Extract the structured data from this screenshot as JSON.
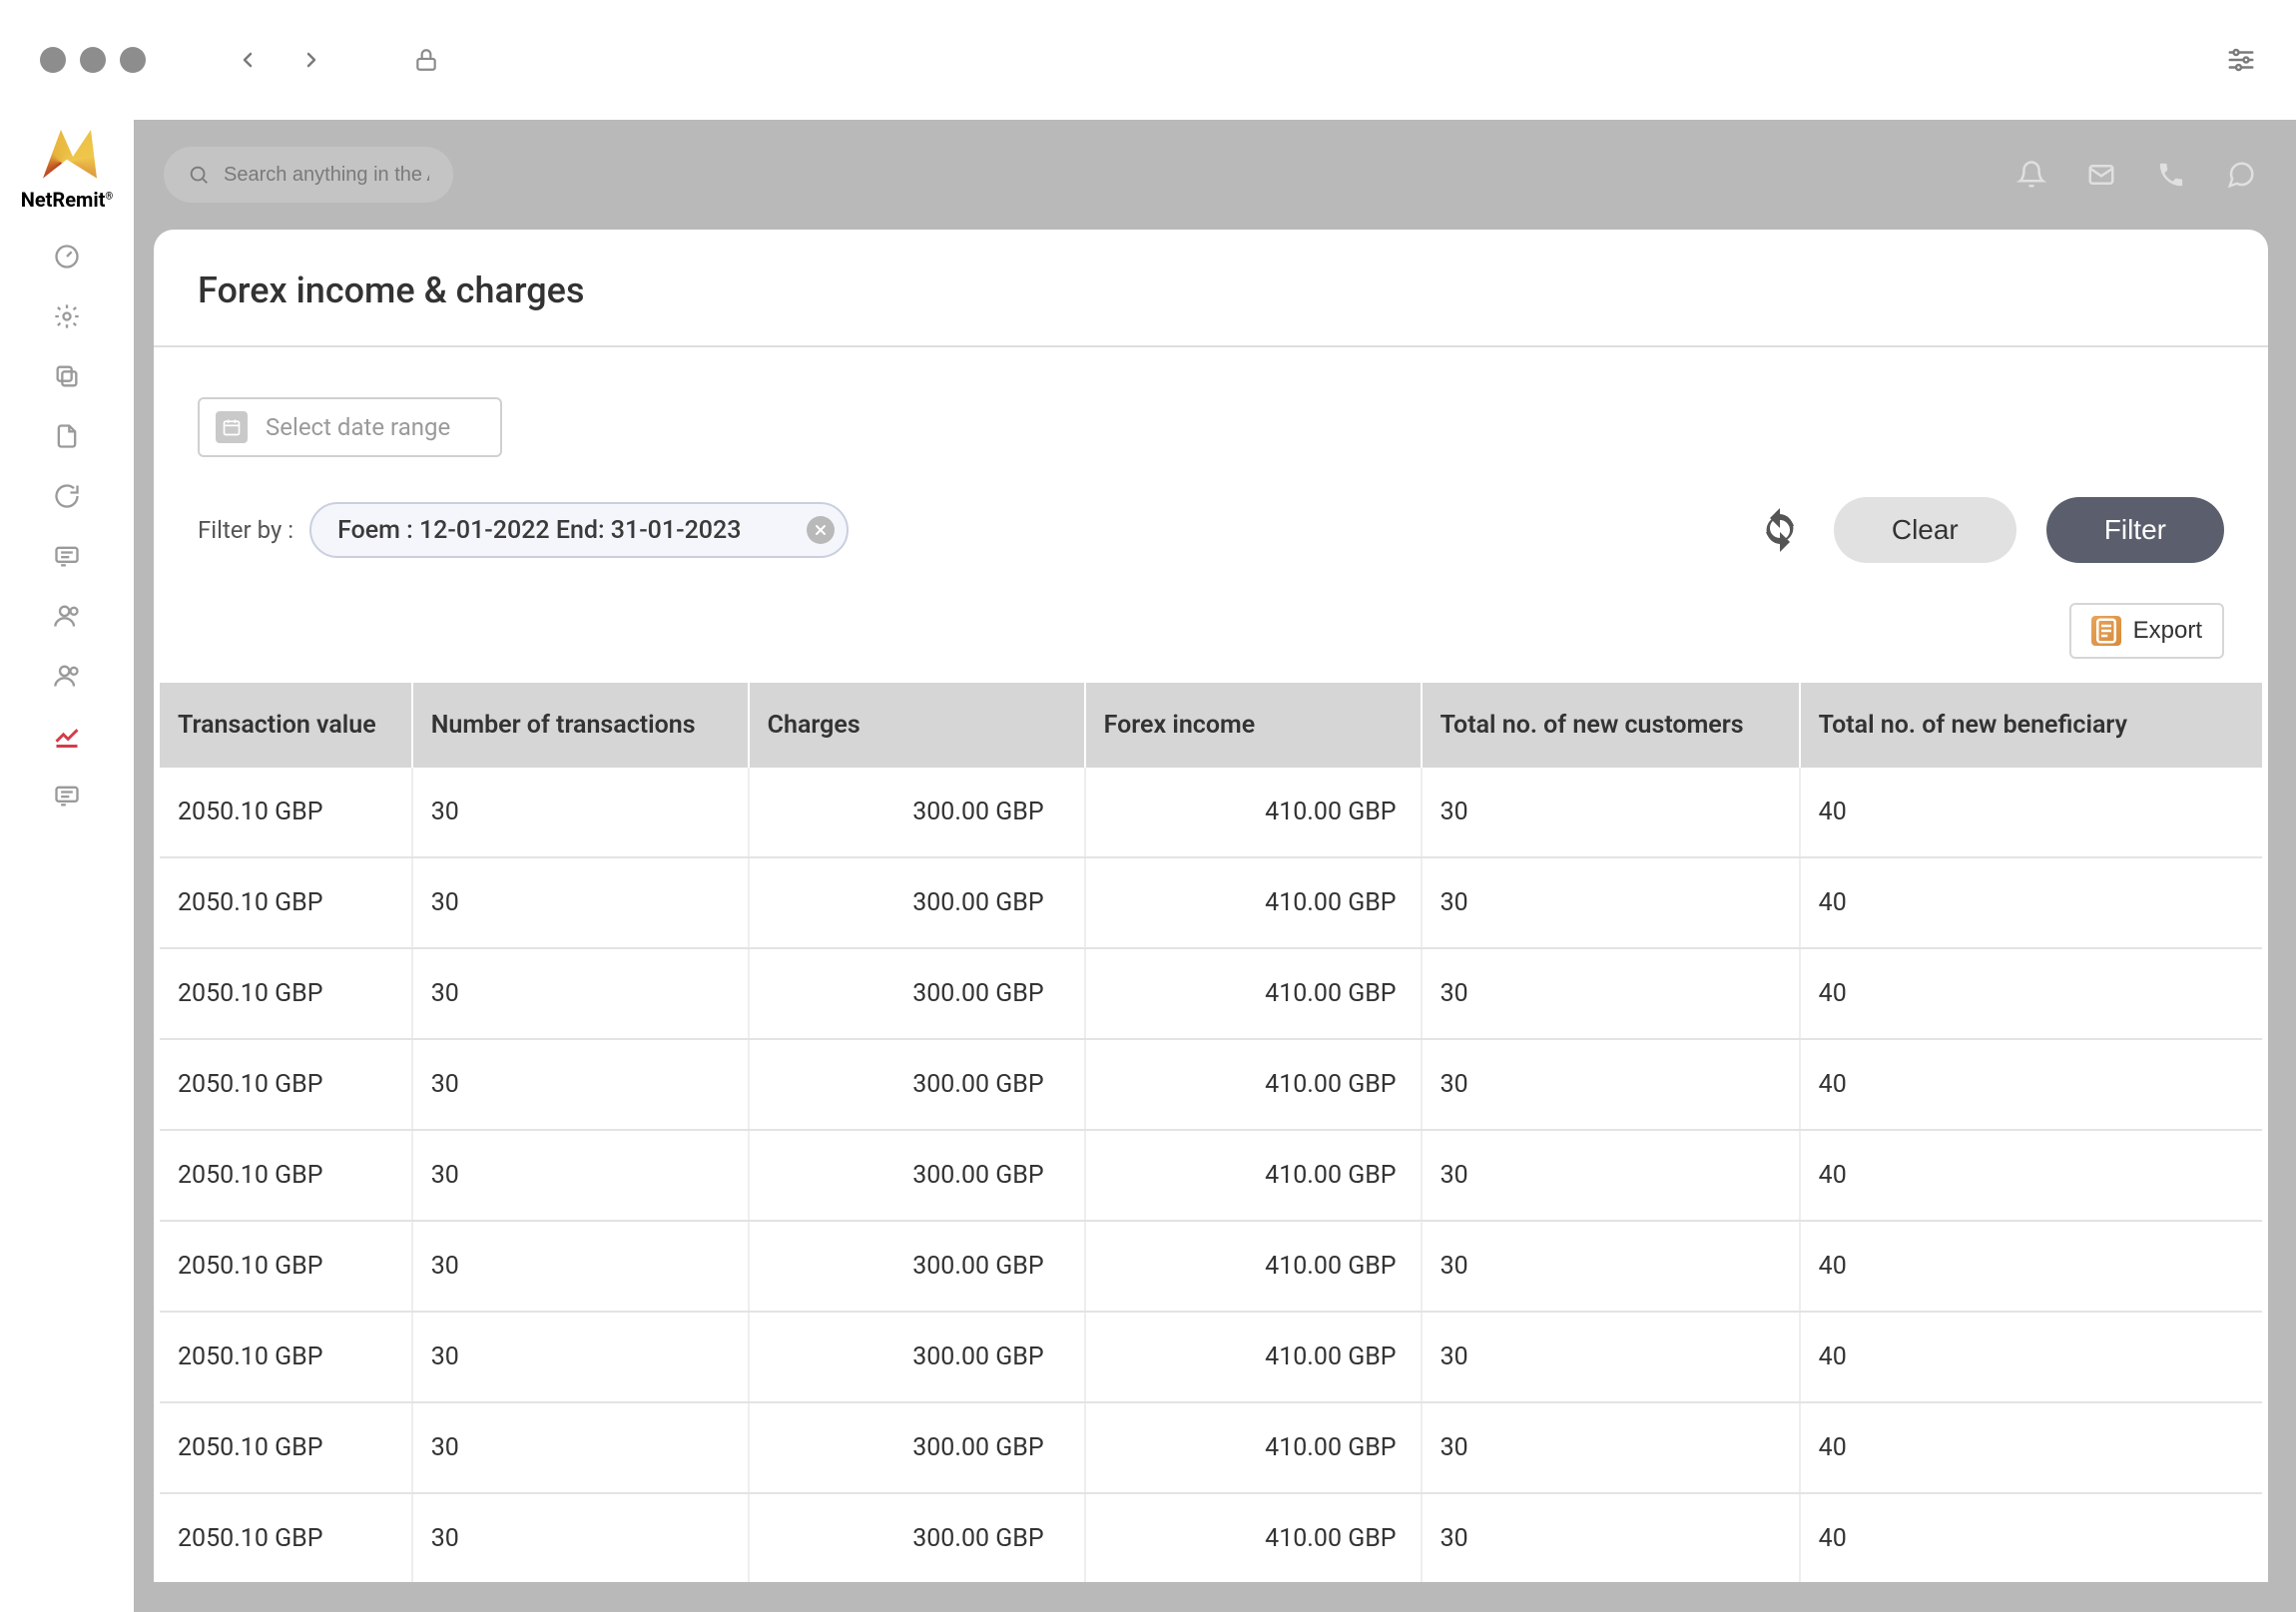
{
  "brand": {
    "name": "NetRemit"
  },
  "search": {
    "placeholder": "Search anything in the App"
  },
  "page": {
    "title": "Forex income & charges"
  },
  "datepicker": {
    "placeholder": "Select date range"
  },
  "filter": {
    "label": "Filter by :",
    "chip_text": "Foem : 12-01-2022 End: 31-01-2023",
    "clear_label": "Clear",
    "filter_label": "Filter"
  },
  "export": {
    "label": "Export"
  },
  "table": {
    "headers": {
      "transaction_value": "Transaction value",
      "num_transactions": "Number of transactions",
      "charges": "Charges",
      "forex_income": "Forex income",
      "new_customers": "Total no. of new customers",
      "new_beneficiary": "Total no. of new beneficiary"
    },
    "rows": [
      {
        "transaction_value": "2050.10 GBP",
        "num_transactions": "30",
        "charges": "300.00 GBP",
        "forex_income": "410.00 GBP",
        "new_customers": "30",
        "new_beneficiary": "40"
      },
      {
        "transaction_value": "2050.10 GBP",
        "num_transactions": "30",
        "charges": "300.00 GBP",
        "forex_income": "410.00 GBP",
        "new_customers": "30",
        "new_beneficiary": "40"
      },
      {
        "transaction_value": "2050.10 GBP",
        "num_transactions": "30",
        "charges": "300.00 GBP",
        "forex_income": "410.00 GBP",
        "new_customers": "30",
        "new_beneficiary": "40"
      },
      {
        "transaction_value": "2050.10 GBP",
        "num_transactions": "30",
        "charges": "300.00 GBP",
        "forex_income": "410.00 GBP",
        "new_customers": "30",
        "new_beneficiary": "40"
      },
      {
        "transaction_value": "2050.10 GBP",
        "num_transactions": "30",
        "charges": "300.00 GBP",
        "forex_income": "410.00 GBP",
        "new_customers": "30",
        "new_beneficiary": "40"
      },
      {
        "transaction_value": "2050.10 GBP",
        "num_transactions": "30",
        "charges": "300.00 GBP",
        "forex_income": "410.00 GBP",
        "new_customers": "30",
        "new_beneficiary": "40"
      },
      {
        "transaction_value": "2050.10 GBP",
        "num_transactions": "30",
        "charges": "300.00 GBP",
        "forex_income": "410.00 GBP",
        "new_customers": "30",
        "new_beneficiary": "40"
      },
      {
        "transaction_value": "2050.10 GBP",
        "num_transactions": "30",
        "charges": "300.00 GBP",
        "forex_income": "410.00 GBP",
        "new_customers": "30",
        "new_beneficiary": "40"
      },
      {
        "transaction_value": "2050.10 GBP",
        "num_transactions": "30",
        "charges": "300.00 GBP",
        "forex_income": "410.00 GBP",
        "new_customers": "30",
        "new_beneficiary": "40"
      }
    ]
  }
}
